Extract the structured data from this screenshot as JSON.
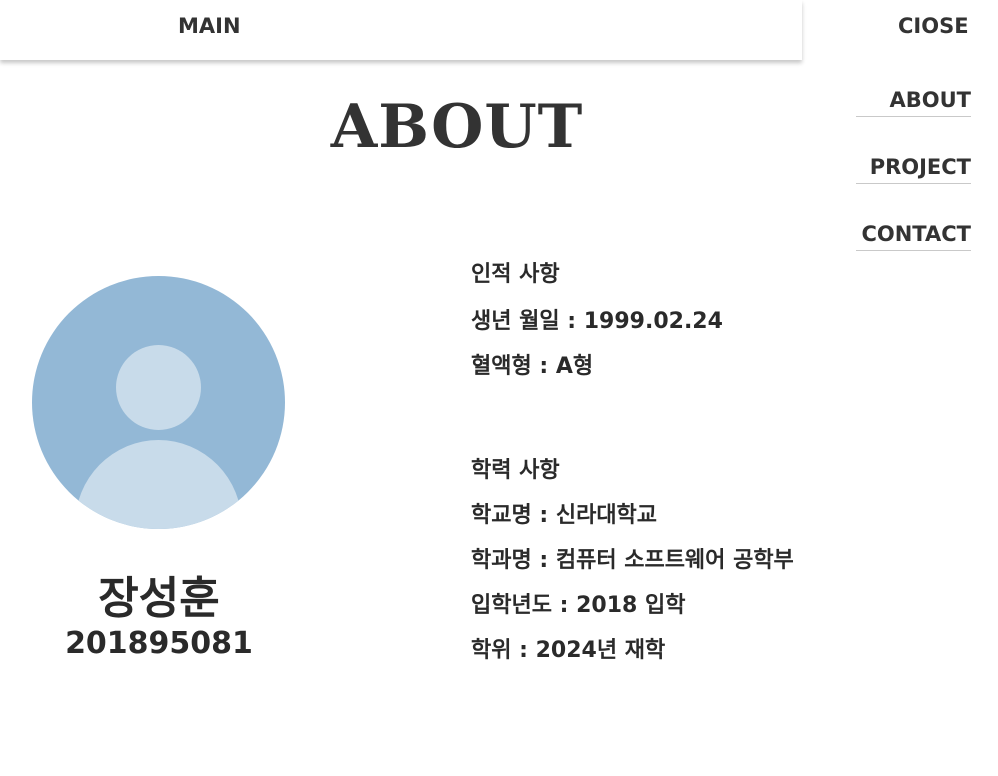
{
  "nav": {
    "main": "MAIN",
    "close": "CIOSE",
    "items": [
      "ABOUT",
      "PROJECT",
      "CONTACT"
    ]
  },
  "page": {
    "title": "ABOUT"
  },
  "profile": {
    "avatar_icon": "user-avatar-icon",
    "name": "장성훈",
    "student_id": "201895081"
  },
  "personal": {
    "heading": "인적 사항",
    "birth": "생년 월일 : 1999.02.24",
    "blood": "혈액형 : A형"
  },
  "education": {
    "heading": "학력 사항",
    "school": "학교명 : 신라대학교",
    "department": "학과명 : 컴퓨터 소프트웨어 공학부",
    "admission": "입학년도 : 2018 입학",
    "degree": "학위 : 2024년 재학"
  },
  "colors": {
    "avatar_bg": "#93b8d6",
    "avatar_fg": "#c8dbea",
    "text": "#2a2a2a"
  }
}
